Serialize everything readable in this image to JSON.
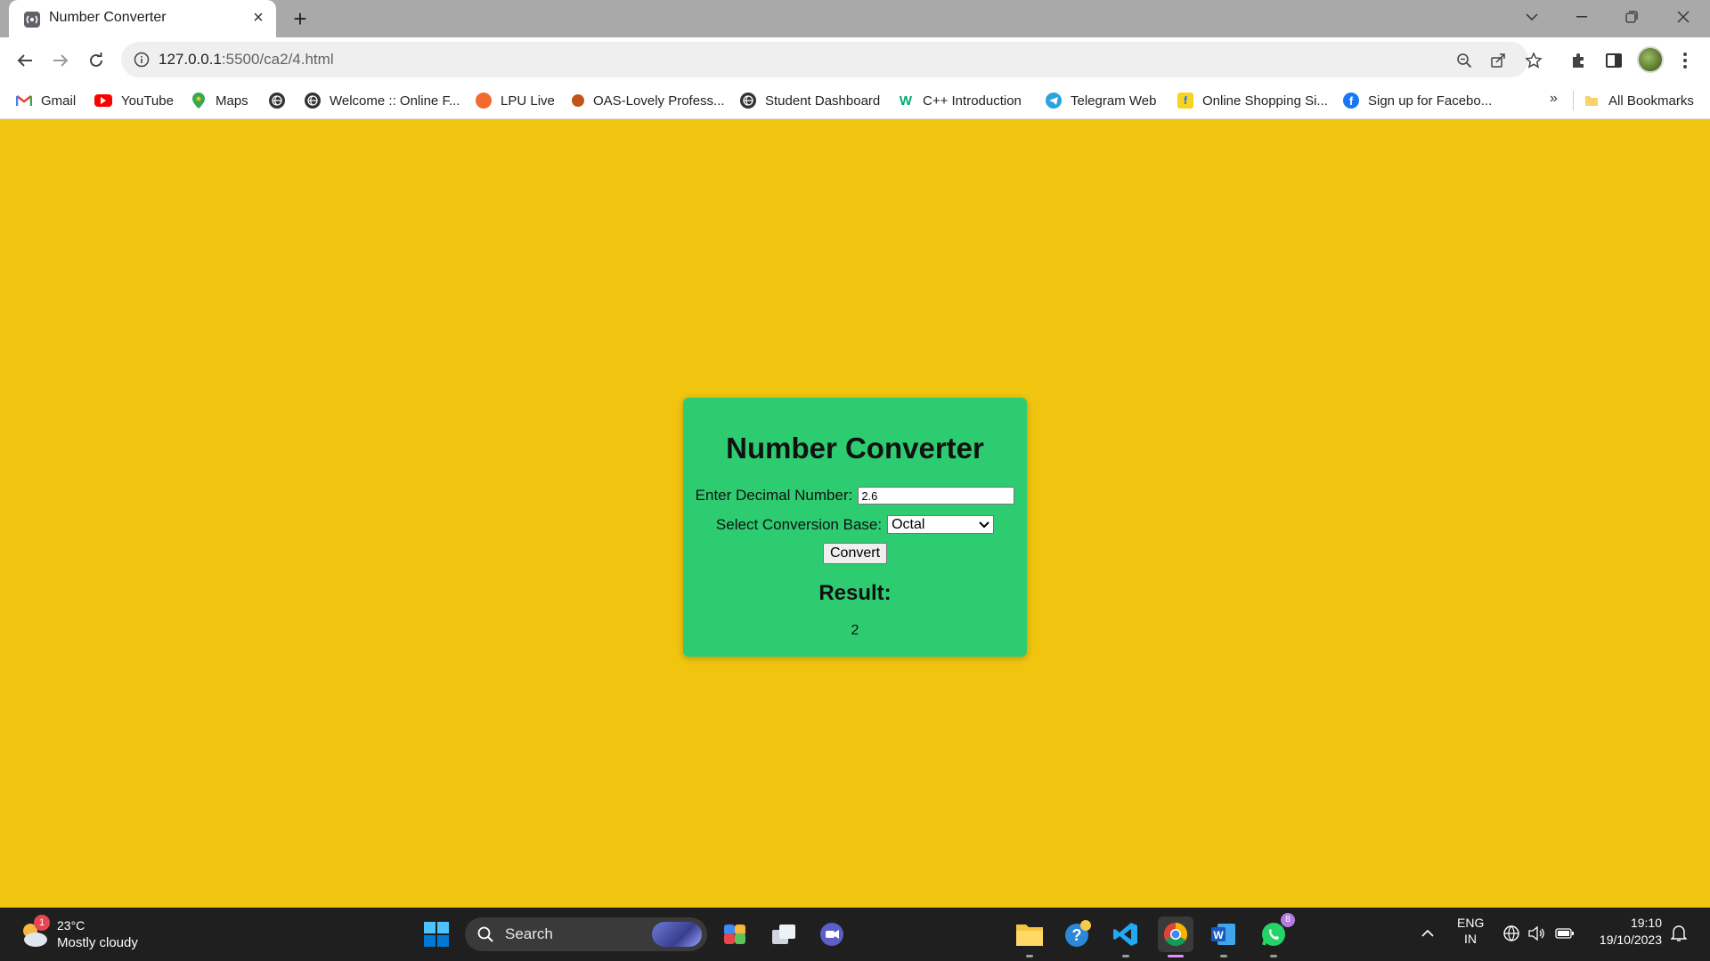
{
  "browser": {
    "tab_title": "Number Converter",
    "url_host": "127.0.0.1",
    "url_path": ":5500/ca2/4.html",
    "bookmarks": [
      {
        "label": "Gmail",
        "icon": "gmail-icon"
      },
      {
        "label": "YouTube",
        "icon": "youtube-icon"
      },
      {
        "label": "Maps",
        "icon": "maps-icon"
      },
      {
        "label": "",
        "icon": "globe-icon"
      },
      {
        "label": "Welcome :: Online F...",
        "icon": "globe-icon"
      },
      {
        "label": "LPU Live",
        "icon": "lpu-live-icon"
      },
      {
        "label": "OAS-Lovely Profess...",
        "icon": "oas-icon"
      },
      {
        "label": "Student Dashboard",
        "icon": "globe-icon"
      },
      {
        "label": "C++ Introduction",
        "icon": "w3-icon"
      },
      {
        "label": "Telegram Web",
        "icon": "telegram-icon"
      },
      {
        "label": "Online Shopping Si...",
        "icon": "flipkart-icon"
      },
      {
        "label": "Sign up for Facebo...",
        "icon": "facebook-icon"
      }
    ],
    "more_bookmarks": "»",
    "all_bookmarks": "All Bookmarks"
  },
  "page": {
    "heading": "Number Converter",
    "decimal_label": "Enter Decimal Number:",
    "decimal_value": "2.6",
    "base_label": "Select Conversion Base:",
    "base_selected": "Octal",
    "convert_label": "Convert",
    "result_heading": "Result:",
    "result_value": "2",
    "colors": {
      "background": "#f1c40f",
      "card": "#2ecc71"
    }
  },
  "taskbar": {
    "weather_badge": "1",
    "weather_temp": "23°C",
    "weather_desc": "Mostly cloudy",
    "search_label": "Search",
    "whatsapp_badge": "8",
    "lang_line1": "ENG",
    "lang_line2": "IN",
    "time": "19:10",
    "date": "19/10/2023"
  }
}
